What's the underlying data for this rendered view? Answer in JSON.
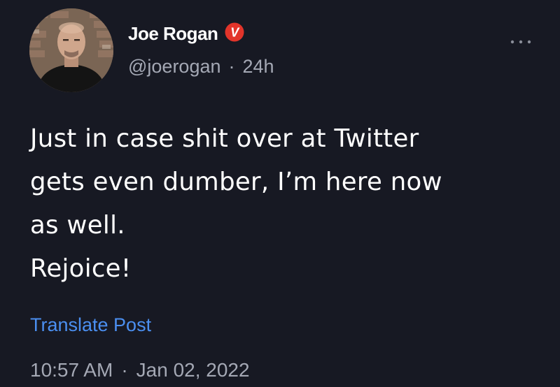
{
  "author": {
    "name": "Joe Rogan",
    "handle": "@joerogan",
    "separator": "·",
    "relative_time": "24h",
    "badge_letter": "V",
    "badge_color": "#e2342a"
  },
  "post": {
    "lines": [
      "Just in case shit over at Twitter",
      "gets even dumber, I’m here now",
      "as well.",
      "Rejoice!"
    ],
    "translate_label": "Translate Post"
  },
  "timestamp": {
    "time": "10:57 AM",
    "separator": "·",
    "date": "Jan 02, 2022"
  },
  "icons": {
    "avatar": "profile-photo",
    "badge": "verified-badge-icon",
    "more": "more-options-icon"
  },
  "colors": {
    "background": "#171923",
    "text": "#ffffff",
    "muted": "#a4a8b4",
    "link": "#4b8ff0"
  }
}
